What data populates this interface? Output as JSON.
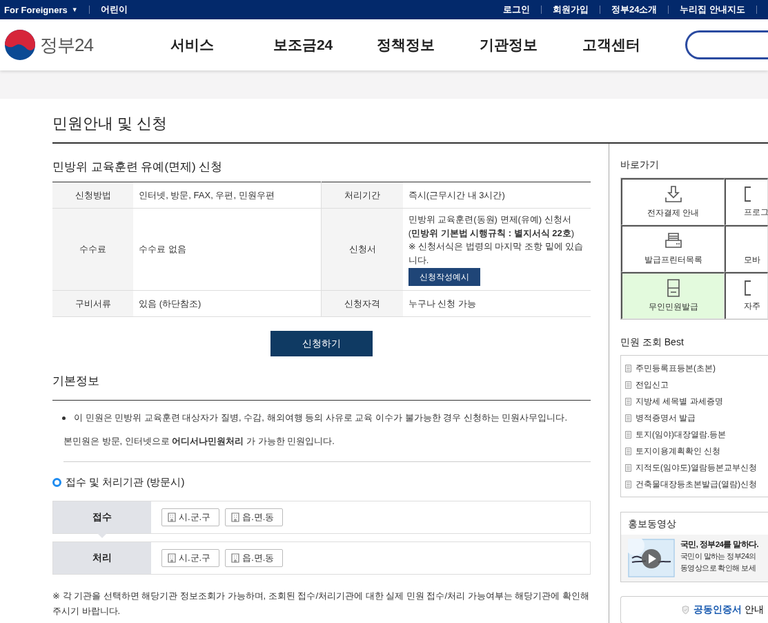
{
  "top_bar": {
    "language_menu": "For Foreigners",
    "language_caret": "▼",
    "kids_link": "어린이",
    "links": [
      "로그인",
      "회원가입",
      "정부24소개",
      "누리집 안내지도"
    ]
  },
  "header": {
    "logo_text": "정부24",
    "nav": [
      "서비스",
      "보조금24",
      "정책정보",
      "기관정보",
      "고객센터"
    ]
  },
  "page_title": "민원안내 및 신청",
  "service": {
    "title": "민방위 교육훈련 유예(면제) 신청",
    "rows": [
      [
        {
          "label": "신청방법",
          "value": "인터넷, 방문, FAX, 우편, 민원우편"
        },
        {
          "label": "처리기간",
          "value": "즉시(근무시간 내 3시간)"
        }
      ],
      [
        {
          "label": "수수료",
          "value": "수수료 없음"
        },
        {
          "label": "신청서",
          "value": "민방위 교육훈련(동원) 면제(유예) 신청서 (**민방위 기본법 시행규칙 : 별지서식 22호**)",
          "note": "※ 신청서식은 법령의 마지막 조항 밑에 있습니다.",
          "button": "신청작성예시"
        }
      ],
      [
        {
          "label": "구비서류",
          "value": "있음 (하단참조)"
        },
        {
          "label": "신청자격",
          "value": "누구나 신청 가능"
        }
      ]
    ],
    "apply_button": "신청하기"
  },
  "basic_info": {
    "title": "기본정보",
    "bullets": [
      "이 민원은 민방위 교육훈련 대상자가 질병, 수감, 해외여행 등의 사유로 교육 이수가 불가능한 경우 신청하는 민원사무입니다."
    ],
    "note": "본민원은 방문, 인터넷으로 **어디서나민원처리** 가 가능한 민원입니다."
  },
  "agencies": {
    "title": "접수 및 처리기관 (방문시)",
    "rows": [
      {
        "label": "접수",
        "options": [
          "시.군.구",
          "읍.면.동"
        ],
        "selected": true
      },
      {
        "label": "처리",
        "options": [
          "시.군.구",
          "읍.면.동"
        ],
        "selected": false
      }
    ],
    "footnote": "※ 각 기관을 선택하면 해당기관 정보조회가 가능하며, 조회된 접수/처리기관에 대한 실제 민원 접수/처리 가능여부는 해당기관에 확인해 주시기 바랍니다."
  },
  "sidebar": {
    "shortcuts_title": "바로가기",
    "shortcuts": [
      {
        "label": "전자결제 안내",
        "selected": false
      },
      {
        "label": "프로그",
        "selected": false
      },
      {
        "label": "발급프린터목록",
        "selected": false
      },
      {
        "label": "모바",
        "selected": false
      },
      {
        "label": "무인민원발급",
        "selected": true
      },
      {
        "label": "자주",
        "selected": false
      }
    ],
    "best_title": "민원 조회 Best",
    "best": [
      "주민등록표등본(초본)",
      "전입신고",
      "지방세 세목별 과세증명",
      "병적증명서 발급",
      "토지(임야)대장열람.등본",
      "토지이용계획확인 신청",
      "지적도(임야도)열람등본교부신청",
      "건축물대장등초본발급(열람)신청"
    ],
    "video_title": "홍보동영상",
    "video": {
      "kind": "picture",
      "title": "국민, 정부24를 말하다.",
      "lines": [
        "국민이 말하는 정부24의",
        "동영상으로 확인해 보세"
      ]
    },
    "cert_button": {
      "highlight": "공동인증서",
      "label": "안내"
    }
  }
}
